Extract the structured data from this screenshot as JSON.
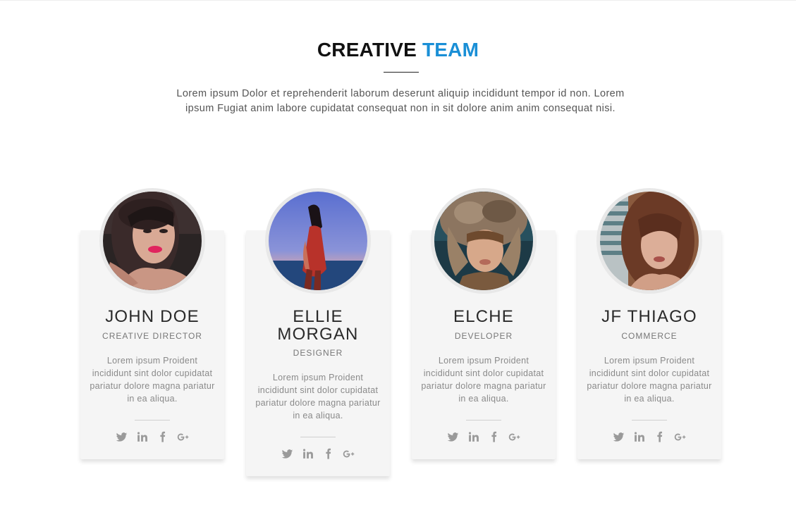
{
  "header": {
    "title_main": "CREATIVE",
    "title_accent": "TEAM",
    "accent_color": "#1a8fd6",
    "intro": "Lorem ipsum Dolor et reprehenderit laborum deserunt aliquip incididunt tempor id non. Lorem ipsum Fugiat anim labore cupidatat consequat non in sit dolore anim anim consequat nisi."
  },
  "team": [
    {
      "name": "JOHN DOE",
      "role": "CREATIVE DIRECTOR",
      "bio": "Lorem ipsum Proident incididunt sint dolor cupidatat pariatur dolore magna pariatur in ea aliqua.",
      "social": [
        "twitter-icon",
        "linkedin-icon",
        "facebook-icon",
        "google-plus-icon"
      ]
    },
    {
      "name": "ELLIE MORGAN",
      "role": "DESIGNER",
      "bio": "Lorem ipsum Proident incididunt sint dolor cupidatat pariatur dolore magna pariatur in ea aliqua.",
      "social": [
        "twitter-icon",
        "linkedin-icon",
        "facebook-icon",
        "google-plus-icon"
      ]
    },
    {
      "name": "ELCHE",
      "role": "DEVELOPER",
      "bio": "Lorem ipsum Proident incididunt sint dolor cupidatat pariatur dolore magna pariatur in ea aliqua.",
      "social": [
        "twitter-icon",
        "linkedin-icon",
        "facebook-icon",
        "google-plus-icon"
      ]
    },
    {
      "name": "JF THIAGO",
      "role": "COMMERCE",
      "bio": "Lorem ipsum Proident incididunt sint dolor cupidatat pariatur dolore magna pariatur in ea aliqua.",
      "social": [
        "twitter-icon",
        "linkedin-icon",
        "facebook-icon",
        "google-plus-icon"
      ]
    }
  ]
}
